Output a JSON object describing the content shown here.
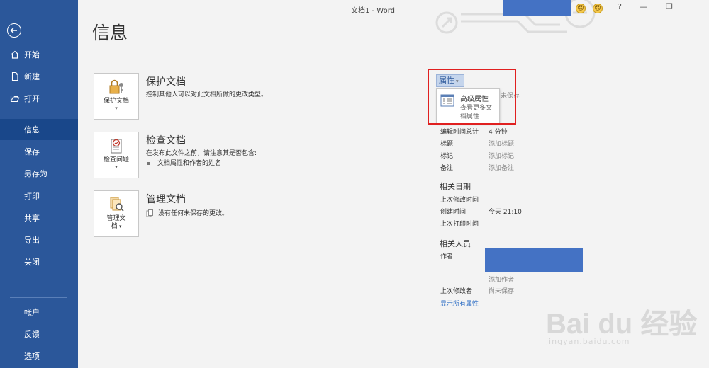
{
  "window": {
    "title": "文档1 - Word"
  },
  "titlebar": {
    "smile": "☺",
    "frown": "☹",
    "help": "?",
    "minimize": "—",
    "restore": "❐"
  },
  "sidebar": {
    "items": [
      {
        "label": "开始",
        "icon": "home-icon"
      },
      {
        "label": "新建",
        "icon": "new-doc-icon"
      },
      {
        "label": "打开",
        "icon": "folder-open-icon"
      },
      {
        "label": "信息",
        "selected": true
      },
      {
        "label": "保存"
      },
      {
        "label": "另存为"
      },
      {
        "label": "打印"
      },
      {
        "label": "共享"
      },
      {
        "label": "导出"
      },
      {
        "label": "关闭"
      },
      {
        "label": "帐户"
      },
      {
        "label": "反馈"
      },
      {
        "label": "选项"
      }
    ]
  },
  "page": {
    "title": "信息"
  },
  "cards": [
    {
      "button": "保护文档",
      "title": "保护文档",
      "desc": "控制其他人可以对此文档所做的更改类型。"
    },
    {
      "button": "检查问题",
      "title": "检查文档",
      "desc": "在发布此文件之前，请注意其是否包含:",
      "bullet": "文档属性和作者的姓名"
    },
    {
      "button_line1": "管理文",
      "button_line2": "档",
      "title": "管理文档",
      "desc": "没有任何未保存的更改。"
    }
  ],
  "properties": {
    "button_label": "属性",
    "dropdown": {
      "title": "高级属性",
      "desc": "查看更多文档属性"
    },
    "peek": "未保存",
    "rows": [
      {
        "label": "编辑时间总计",
        "value": "4 分钟"
      },
      {
        "label": "标题",
        "value": "添加标题"
      },
      {
        "label": "标记",
        "value": "添加标记"
      },
      {
        "label": "备注",
        "value": "添加备注"
      }
    ],
    "dates": {
      "heading": "相关日期",
      "last_modified": "上次修改时间",
      "created": "创建时间",
      "created_value": "今天 21:10",
      "last_printed": "上次打印时间"
    },
    "people": {
      "heading": "相关人员",
      "author": "作者",
      "add_author": "添加作者",
      "last_modified_by": "上次修改者",
      "last_modified_by_value": "尚未保存"
    },
    "show_all": "显示所有属性"
  },
  "watermark": {
    "logo": "Bai du 经验",
    "url": "jingyan.baidu.com"
  },
  "colors": {
    "sidebar": "#2b579a",
    "selected": "#19478a",
    "highlight": "#e02020",
    "redacted": "#4472c4"
  }
}
